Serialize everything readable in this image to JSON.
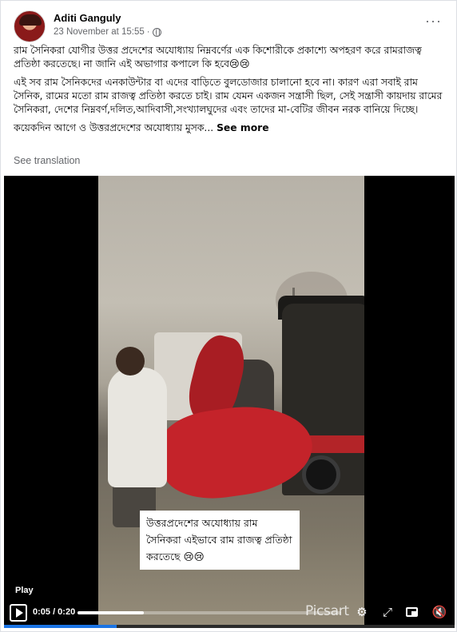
{
  "post": {
    "author": "Aditi Ganguly",
    "timestamp": "23 November at 15:55",
    "separator": "·",
    "paragraphs": [
      "রাম সৈনিকরা যোগীর উত্তর প্রদেশের অযোধ্যায় নিম্নবর্ণের এক কিশোরীকে প্রকাশ্যে অপহরণ করে রামরাজত্ব প্রতিষ্ঠা করতেছে। না জানি এই অভাগার কপালে কি হবে😢😢",
      "এই সব রাম সৈনিকদের এনকাউন্টার বা এদের বাড়িতে বুলডোজার চালানো হবে না। কারণ এরা সবাই রাম সৈনিক, রামের মতো রাম রাজত্ব প্রতিষ্ঠা করতে চাই। রাম যেমন একজন সন্ত্রাসী ছিল, সেই সন্ত্রাসী কায়দায় রামের সৈনিকরা, দেশের নিম্নবর্ণ,দলিত,আদিবাসী,সংখ্যালঘুদের এবং তাদের  মা-বেটির জীবন নরক বানিয়ে দিচ্ছে।"
    ],
    "truncated_text": "কয়েকদিন আগে ও উত্তরপ্রদেশের অযোধ্যায় মুসক...",
    "see_more": "See more",
    "see_translation": "See translation"
  },
  "video": {
    "caption": "উত্তরপ্রদেশের অযোধ্যায় রাম সৈনিকরা এইভাবে রাম রাজত্ব প্রতিষ্ঠা করতেছে 😢😢",
    "play_label": "Play",
    "time": "0:05 / 0:20",
    "progress_fraction": 0.25,
    "watermark": "Picsart",
    "icons": [
      "play-icon",
      "gear-icon",
      "expand-icon",
      "picture-in-picture-icon",
      "volume-muted-icon"
    ]
  },
  "colors": {
    "text_primary": "#050505",
    "text_secondary": "#65676b",
    "accent": "#1b74e4"
  }
}
